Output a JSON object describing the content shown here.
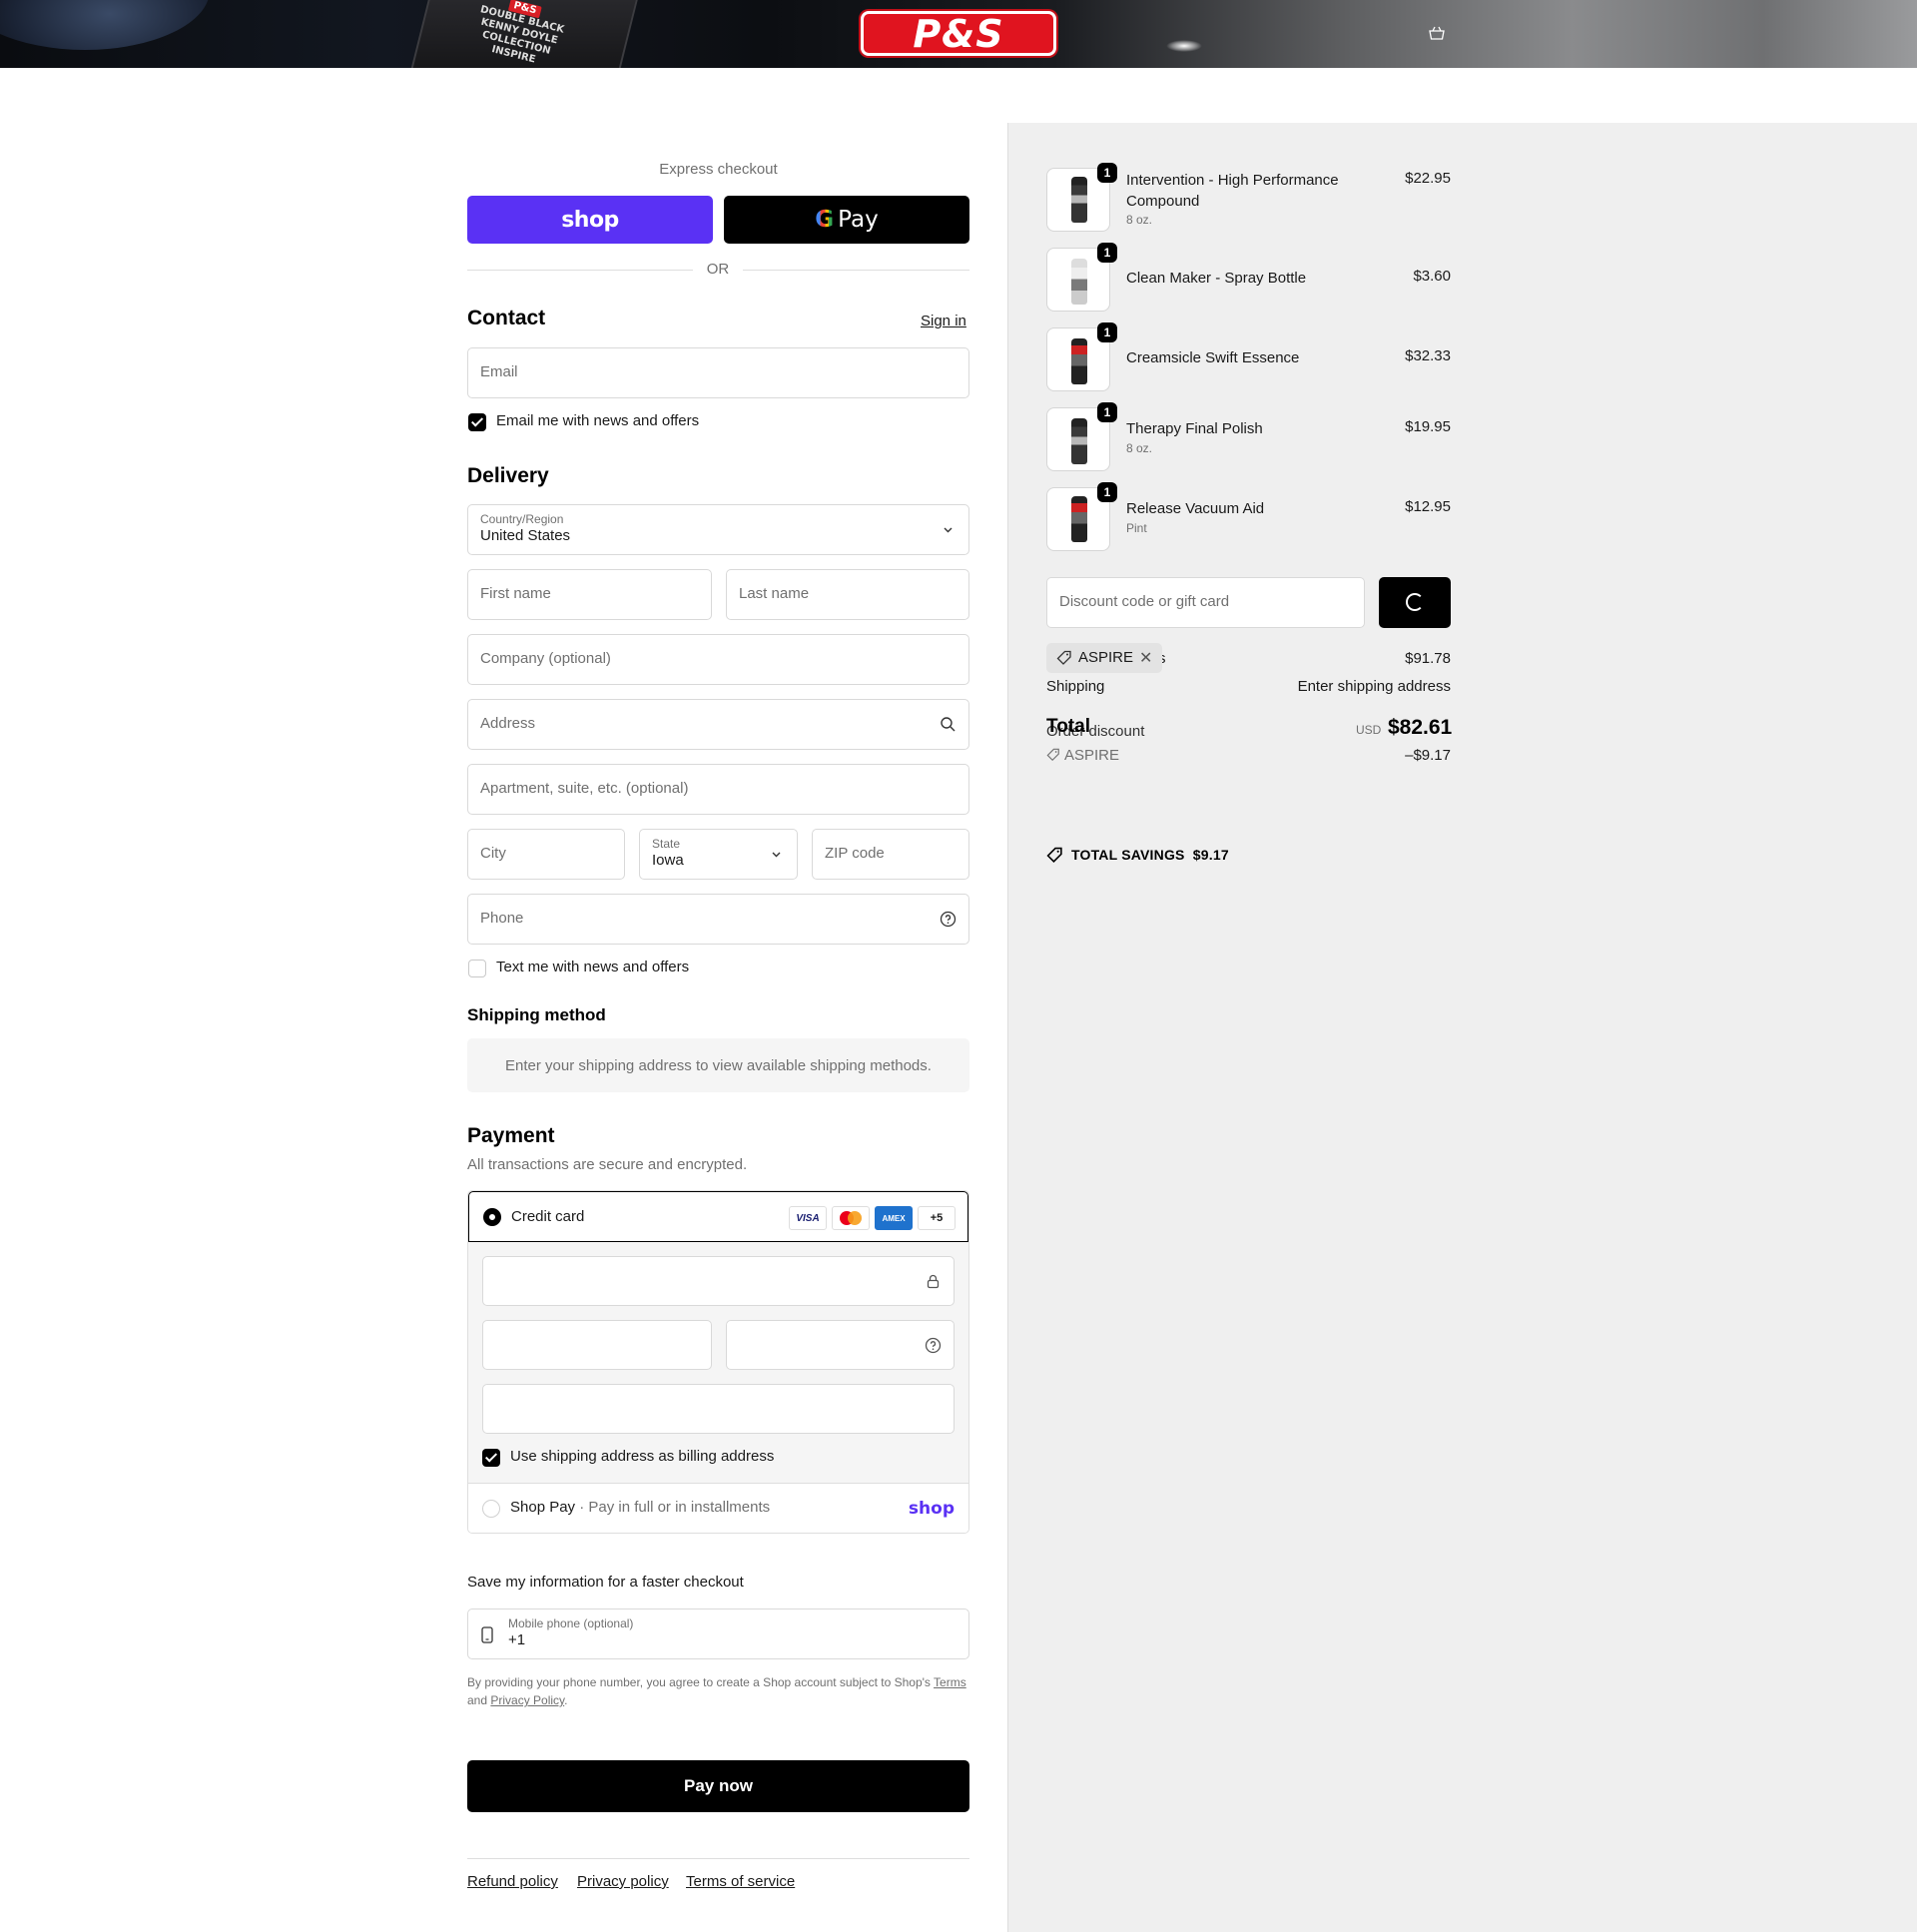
{
  "header": {
    "logo_text": "P&S",
    "bottle_brand": "P&S",
    "bottle_line1": "DOUBLE BLACK",
    "bottle_line2": "KENNY DOYLE",
    "bottle_line3": "COLLECTION",
    "bottle_line4": "INSPIRE"
  },
  "express": {
    "label": "Express checkout",
    "shop_label": "shop",
    "gpay_g": "G",
    "gpay_label": "Pay",
    "or_label": "OR"
  },
  "contact": {
    "title": "Contact",
    "sign_in": "Sign in",
    "email_placeholder": "Email",
    "email_news_label": "Email me with news and offers",
    "email_news_checked": true
  },
  "delivery": {
    "title": "Delivery",
    "country_label": "Country/Region",
    "country_value": "United States",
    "first_name_placeholder": "First name",
    "last_name_placeholder": "Last name",
    "company_placeholder": "Company (optional)",
    "address_placeholder": "Address",
    "apartment_placeholder": "Apartment, suite, etc. (optional)",
    "city_placeholder": "City",
    "state_label": "State",
    "state_value": "Iowa",
    "zip_placeholder": "ZIP code",
    "phone_placeholder": "Phone",
    "text_news_label": "Text me with news and offers",
    "text_news_checked": false
  },
  "shipping_method": {
    "title": "Shipping method",
    "notice": "Enter your shipping address to view available shipping methods."
  },
  "payment": {
    "title": "Payment",
    "subtitle": "All transactions are secure and encrypted.",
    "credit_card_label": "Credit card",
    "card_logos": [
      "VISA",
      "Mastercard",
      "AMEX",
      "+5"
    ],
    "billing_same_label": "Use shipping address as billing address",
    "billing_same_checked": true,
    "shop_pay_label": "Shop Pay",
    "shop_pay_sep": "·",
    "shop_pay_sub": "Pay in full or in installments",
    "shop_pay_word": "shop"
  },
  "save_info": {
    "title": "Save my information for a faster checkout",
    "mobile_label": "Mobile phone (optional)",
    "mobile_value": "+1",
    "fine_print_1": "By providing your phone number, you agree to create a Shop account subject to Shop's",
    "terms_link": "Terms",
    "and_text": "and",
    "privacy_link": "Privacy Policy",
    "period": "."
  },
  "pay_now_label": "Pay now",
  "footer_links": [
    "Refund policy",
    "Privacy policy",
    "Terms of service"
  ],
  "summary": {
    "items": [
      {
        "name": "Intervention - High Performance Compound",
        "variant": "8 oz.",
        "price": "$22.95",
        "qty": "1"
      },
      {
        "name": "Clean Maker - Spray Bottle",
        "variant": "",
        "price": "$3.60",
        "qty": "1"
      },
      {
        "name": "Creamsicle Swift Essence",
        "variant": "",
        "price": "$32.33",
        "qty": "1"
      },
      {
        "name": "Therapy Final Polish",
        "variant": "8 oz.",
        "price": "$19.95",
        "qty": "1"
      },
      {
        "name": "Release Vacuum Aid",
        "variant": "Pint",
        "price": "$12.95",
        "qty": "1"
      }
    ],
    "discount_placeholder": "Discount code or gift card",
    "applied_code": "ASPIRE",
    "subtotal_suffix": "s",
    "subtotal_value": "$91.78",
    "shipping_label": "Shipping",
    "shipping_value": "Enter shipping address",
    "order_discount_label": "Order discount",
    "order_discount_code": "ASPIRE",
    "order_discount_value": "–$9.17",
    "total_label": "Total",
    "currency": "USD",
    "total_value": "$82.61",
    "savings_label": "TOTAL SAVINGS",
    "savings_value": "$9.17"
  },
  "colors": {
    "shop_purple": "#5a31f4",
    "brand_red": "#e0141f",
    "summary_bg": "#efefef"
  }
}
